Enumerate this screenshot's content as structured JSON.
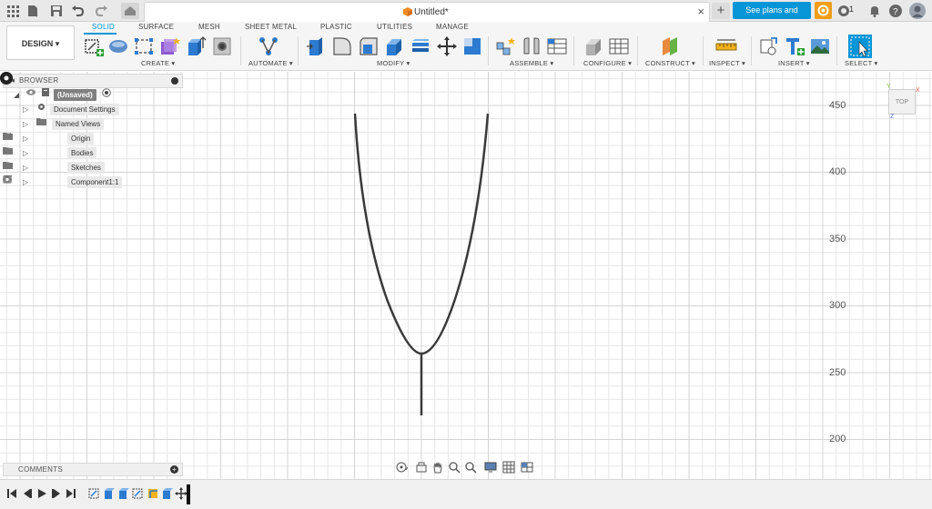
{
  "titlebar": {
    "document_title": "Untitled*",
    "close_glyph": "×",
    "new_tab_glyph": "+",
    "plans_button": "See plans and pricing",
    "notifications_count": "1",
    "icons": [
      "grid-icon",
      "file-icon",
      "save-icon",
      "undo-icon",
      "redo-icon",
      "home-icon",
      "job-status-icon",
      "bell-icon",
      "help-icon",
      "user-avatar-icon"
    ]
  },
  "ribbon": {
    "workspace_button": "DESIGN ▾",
    "tabs": [
      "SOLID",
      "SURFACE",
      "MESH",
      "SHEET METAL",
      "PLASTIC",
      "UTILITIES",
      "MANAGE"
    ],
    "active_tab": "SOLID",
    "groups": [
      {
        "label": "CREATE ▾"
      },
      {
        "label": "AUTOMATE ▾"
      },
      {
        "label": "MODIFY ▾"
      },
      {
        "label": "ASSEMBLE ▾"
      },
      {
        "label": "CONFIGURE ▾"
      },
      {
        "label": "CONSTRUCT ▾"
      },
      {
        "label": "INSPECT ▾"
      },
      {
        "label": "INSERT ▾"
      },
      {
        "label": "SELECT ▾"
      }
    ],
    "accent_color": "#0696d7"
  },
  "browser": {
    "title": "BROWSER",
    "items": [
      {
        "label": "(Unsaved)"
      },
      {
        "label": "Document Settings"
      },
      {
        "label": "Named Views"
      },
      {
        "label": "Origin"
      },
      {
        "label": "Bodies"
      },
      {
        "label": "Sketches"
      },
      {
        "label": "Component1:1"
      }
    ]
  },
  "viewcube": {
    "face": "TOP",
    "axis_x": "X",
    "axis_y": "Y",
    "axis_z": "Z"
  },
  "ruler": {
    "labels": [
      "450",
      "400",
      "350",
      "300",
      "250",
      "200"
    ]
  },
  "comments": {
    "title": "COMMENTS",
    "add_glyph": "+"
  },
  "navbar": {
    "icons": [
      "orbit-icon",
      "look-at-icon",
      "pan-icon",
      "zoom-icon",
      "zoom-window-icon",
      "display-settings-icon",
      "grid-settings-icon",
      "viewports-icon"
    ]
  },
  "timeline": {
    "controls": [
      "go-to-start-icon",
      "step-back-icon",
      "play-icon",
      "step-forward-icon",
      "go-to-end-icon"
    ],
    "features": [
      "sketch-feature",
      "extrude-feature",
      "extrude-feature",
      "sketch-feature",
      "extrude-feature",
      "extrude-feature",
      "move-feature"
    ]
  }
}
